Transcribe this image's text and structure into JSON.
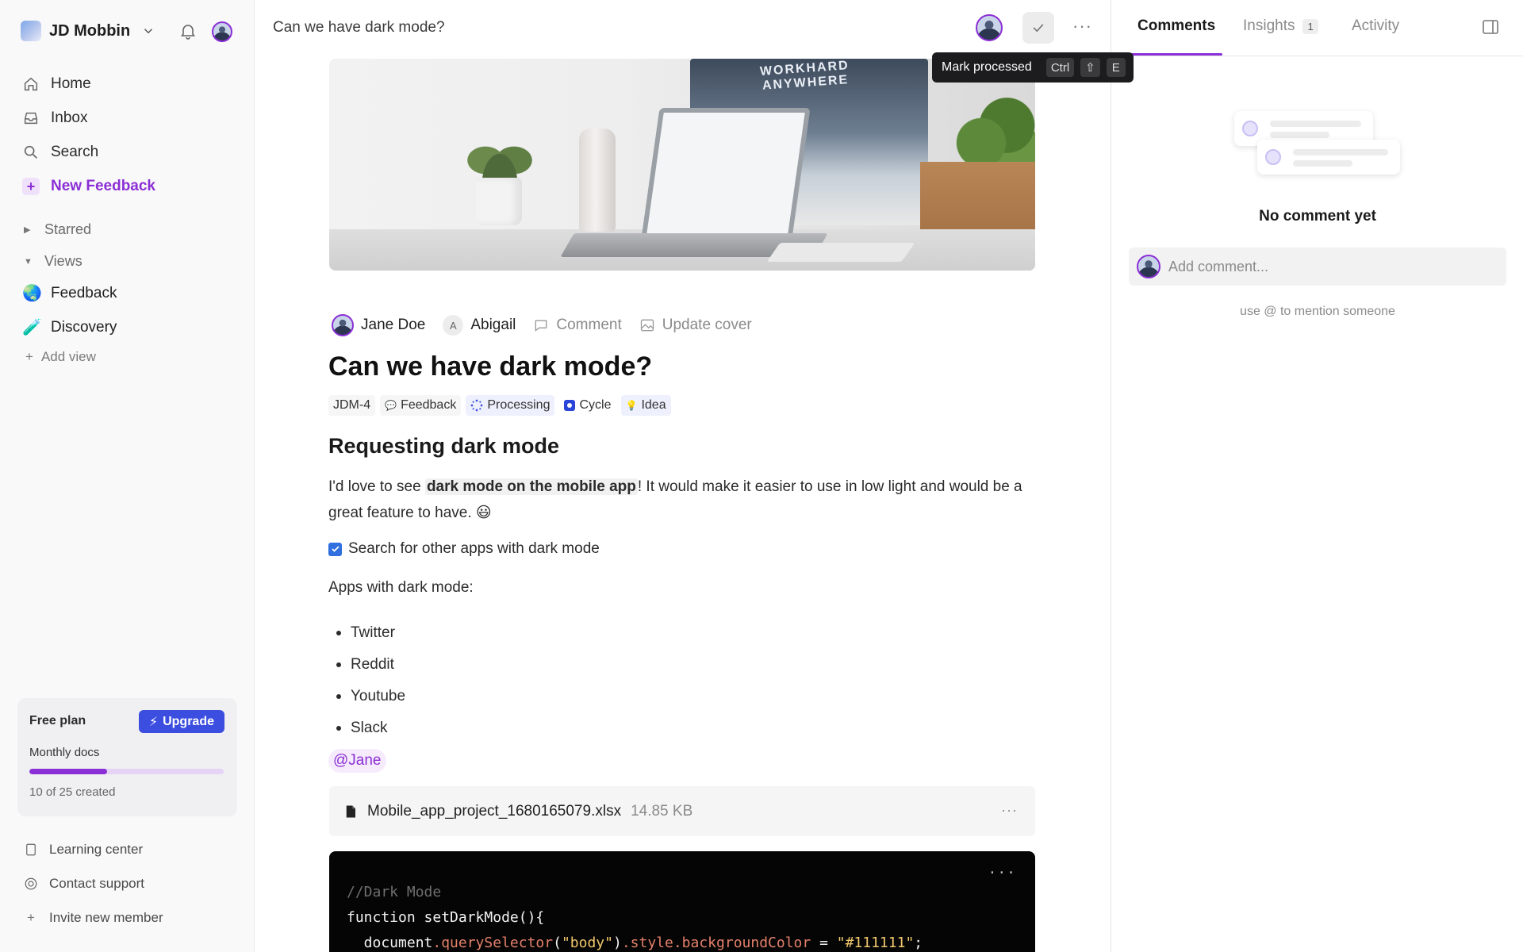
{
  "workspace": {
    "name": "JD Mobbin"
  },
  "nav": {
    "home": "Home",
    "inbox": "Inbox",
    "search": "Search",
    "new_feedback": "New Feedback"
  },
  "sections": {
    "starred": "Starred",
    "views": "Views"
  },
  "views": [
    {
      "label": "Feedback",
      "icon": "🌏"
    },
    {
      "label": "Discovery",
      "icon": "🧪"
    }
  ],
  "add_view": "Add view",
  "plan": {
    "title": "Free plan",
    "upgrade": "Upgrade",
    "subtitle": "Monthly docs",
    "progress": 0.4,
    "count": "10 of 25 created"
  },
  "footer": {
    "learning": "Learning center",
    "support": "Contact support",
    "invite": "Invite new member"
  },
  "topbar": {
    "title": "Can we have dark mode?",
    "tooltip": "Mark processed",
    "shortcut": [
      "Ctrl",
      "⇧",
      "E"
    ]
  },
  "doc": {
    "author": "Jane Doe",
    "assignee": "Abigail",
    "assignee_initial": "A",
    "comment_action": "Comment",
    "cover_action": "Update cover",
    "cover_text": "WORKHARD ANYWHERE",
    "title": "Can we have dark mode?",
    "tags": {
      "id": "JDM-4",
      "type": "Feedback",
      "status": "Processing",
      "cycle": "Cycle",
      "idea": "Idea"
    },
    "heading": "Requesting dark mode",
    "para_before": "I'd love to see ",
    "para_highlight": "dark mode on the mobile app",
    "para_after": "! It would make it easier to use in low light and would be a great feature to have. 😃",
    "task": "Search for other apps with dark mode",
    "apps_label": "Apps with dark mode:",
    "apps": [
      "Twitter",
      "Reddit",
      "Youtube",
      "Slack"
    ],
    "mention": "@Jane",
    "file": {
      "name": "Mobile_app_project_1680165079.xlsx",
      "size": "14.85 KB"
    },
    "code": {
      "comment": "//Dark Mode",
      "line1": "function setDarkMode(){",
      "line2_a": "  document",
      "line2_b": ".querySelector",
      "line2_c": "(",
      "line2_d": "\"body\"",
      "line2_e": ")",
      "line2_f": ".style.backgroundColor",
      "line2_g": " = ",
      "line2_h": "\"#111111\"",
      "line2_i": ";"
    }
  },
  "panel": {
    "tabs": {
      "comments": "Comments",
      "insights": "Insights",
      "insights_count": "1",
      "activity": "Activity"
    },
    "empty": "No comment yet",
    "placeholder": "Add comment...",
    "hint": "use @ to mention someone"
  }
}
